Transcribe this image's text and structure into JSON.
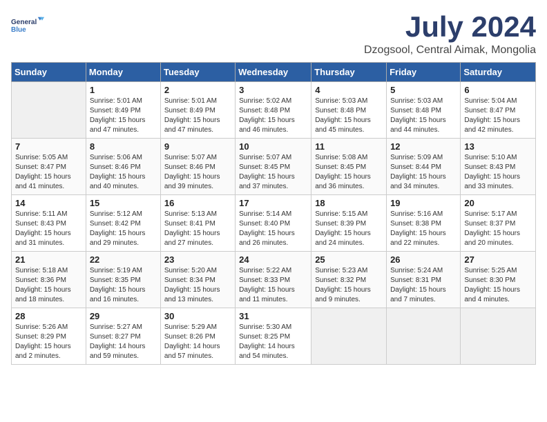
{
  "logo": {
    "line1": "General",
    "line2": "Blue"
  },
  "title": "July 2024",
  "location": "Dzogsool, Central Aimak, Mongolia",
  "days_header": [
    "Sunday",
    "Monday",
    "Tuesday",
    "Wednesday",
    "Thursday",
    "Friday",
    "Saturday"
  ],
  "weeks": [
    [
      {
        "day": "",
        "info": ""
      },
      {
        "day": "1",
        "info": "Sunrise: 5:01 AM\nSunset: 8:49 PM\nDaylight: 15 hours\nand 47 minutes."
      },
      {
        "day": "2",
        "info": "Sunrise: 5:01 AM\nSunset: 8:49 PM\nDaylight: 15 hours\nand 47 minutes."
      },
      {
        "day": "3",
        "info": "Sunrise: 5:02 AM\nSunset: 8:48 PM\nDaylight: 15 hours\nand 46 minutes."
      },
      {
        "day": "4",
        "info": "Sunrise: 5:03 AM\nSunset: 8:48 PM\nDaylight: 15 hours\nand 45 minutes."
      },
      {
        "day": "5",
        "info": "Sunrise: 5:03 AM\nSunset: 8:48 PM\nDaylight: 15 hours\nand 44 minutes."
      },
      {
        "day": "6",
        "info": "Sunrise: 5:04 AM\nSunset: 8:47 PM\nDaylight: 15 hours\nand 42 minutes."
      }
    ],
    [
      {
        "day": "7",
        "info": "Sunrise: 5:05 AM\nSunset: 8:47 PM\nDaylight: 15 hours\nand 41 minutes."
      },
      {
        "day": "8",
        "info": "Sunrise: 5:06 AM\nSunset: 8:46 PM\nDaylight: 15 hours\nand 40 minutes."
      },
      {
        "day": "9",
        "info": "Sunrise: 5:07 AM\nSunset: 8:46 PM\nDaylight: 15 hours\nand 39 minutes."
      },
      {
        "day": "10",
        "info": "Sunrise: 5:07 AM\nSunset: 8:45 PM\nDaylight: 15 hours\nand 37 minutes."
      },
      {
        "day": "11",
        "info": "Sunrise: 5:08 AM\nSunset: 8:45 PM\nDaylight: 15 hours\nand 36 minutes."
      },
      {
        "day": "12",
        "info": "Sunrise: 5:09 AM\nSunset: 8:44 PM\nDaylight: 15 hours\nand 34 minutes."
      },
      {
        "day": "13",
        "info": "Sunrise: 5:10 AM\nSunset: 8:43 PM\nDaylight: 15 hours\nand 33 minutes."
      }
    ],
    [
      {
        "day": "14",
        "info": "Sunrise: 5:11 AM\nSunset: 8:43 PM\nDaylight: 15 hours\nand 31 minutes."
      },
      {
        "day": "15",
        "info": "Sunrise: 5:12 AM\nSunset: 8:42 PM\nDaylight: 15 hours\nand 29 minutes."
      },
      {
        "day": "16",
        "info": "Sunrise: 5:13 AM\nSunset: 8:41 PM\nDaylight: 15 hours\nand 27 minutes."
      },
      {
        "day": "17",
        "info": "Sunrise: 5:14 AM\nSunset: 8:40 PM\nDaylight: 15 hours\nand 26 minutes."
      },
      {
        "day": "18",
        "info": "Sunrise: 5:15 AM\nSunset: 8:39 PM\nDaylight: 15 hours\nand 24 minutes."
      },
      {
        "day": "19",
        "info": "Sunrise: 5:16 AM\nSunset: 8:38 PM\nDaylight: 15 hours\nand 22 minutes."
      },
      {
        "day": "20",
        "info": "Sunrise: 5:17 AM\nSunset: 8:37 PM\nDaylight: 15 hours\nand 20 minutes."
      }
    ],
    [
      {
        "day": "21",
        "info": "Sunrise: 5:18 AM\nSunset: 8:36 PM\nDaylight: 15 hours\nand 18 minutes."
      },
      {
        "day": "22",
        "info": "Sunrise: 5:19 AM\nSunset: 8:35 PM\nDaylight: 15 hours\nand 16 minutes."
      },
      {
        "day": "23",
        "info": "Sunrise: 5:20 AM\nSunset: 8:34 PM\nDaylight: 15 hours\nand 13 minutes."
      },
      {
        "day": "24",
        "info": "Sunrise: 5:22 AM\nSunset: 8:33 PM\nDaylight: 15 hours\nand 11 minutes."
      },
      {
        "day": "25",
        "info": "Sunrise: 5:23 AM\nSunset: 8:32 PM\nDaylight: 15 hours\nand 9 minutes."
      },
      {
        "day": "26",
        "info": "Sunrise: 5:24 AM\nSunset: 8:31 PM\nDaylight: 15 hours\nand 7 minutes."
      },
      {
        "day": "27",
        "info": "Sunrise: 5:25 AM\nSunset: 8:30 PM\nDaylight: 15 hours\nand 4 minutes."
      }
    ],
    [
      {
        "day": "28",
        "info": "Sunrise: 5:26 AM\nSunset: 8:29 PM\nDaylight: 15 hours\nand 2 minutes."
      },
      {
        "day": "29",
        "info": "Sunrise: 5:27 AM\nSunset: 8:27 PM\nDaylight: 14 hours\nand 59 minutes."
      },
      {
        "day": "30",
        "info": "Sunrise: 5:29 AM\nSunset: 8:26 PM\nDaylight: 14 hours\nand 57 minutes."
      },
      {
        "day": "31",
        "info": "Sunrise: 5:30 AM\nSunset: 8:25 PM\nDaylight: 14 hours\nand 54 minutes."
      },
      {
        "day": "",
        "info": ""
      },
      {
        "day": "",
        "info": ""
      },
      {
        "day": "",
        "info": ""
      }
    ]
  ]
}
